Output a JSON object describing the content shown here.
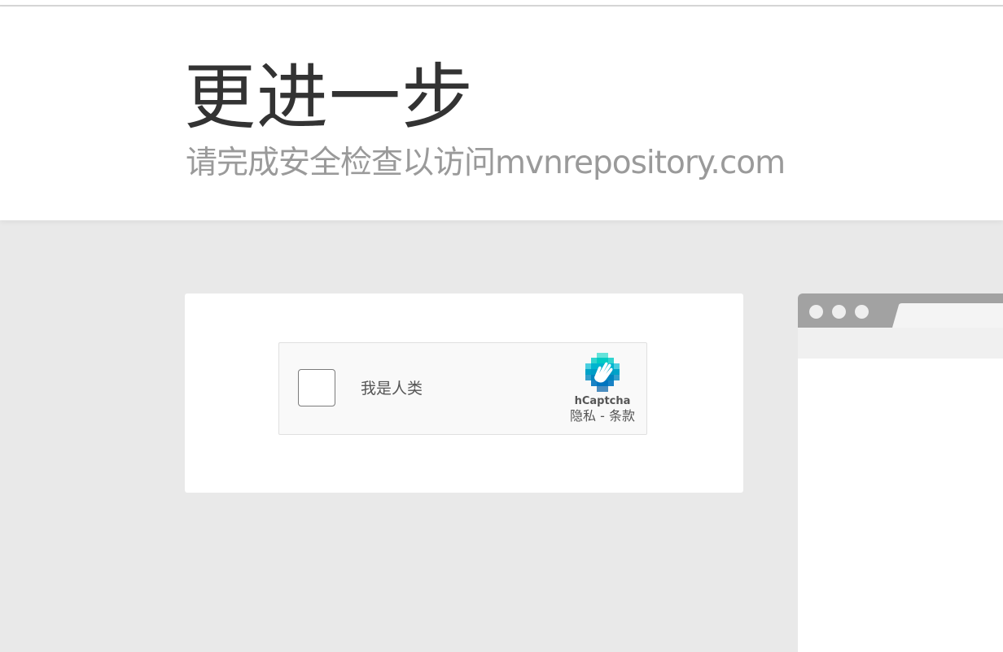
{
  "header": {
    "title": "更进一步",
    "subtitle": "请完成安全检查以访问mvnrepository.com"
  },
  "captcha": {
    "label": "我是人类",
    "brand": "hCaptcha",
    "privacy_link": "隐私",
    "separator": " - ",
    "terms_link": "条款",
    "checked": false,
    "logo_icon": "hcaptcha-hand-logo-icon"
  },
  "browser_illustration": {
    "icon": "browser-window-icon"
  },
  "colors": {
    "background": "#e9e9e9",
    "heading": "#333333",
    "subheading": "#9a9a9a",
    "logo_teal": "#00a9c9",
    "logo_blue": "#0074bf"
  }
}
